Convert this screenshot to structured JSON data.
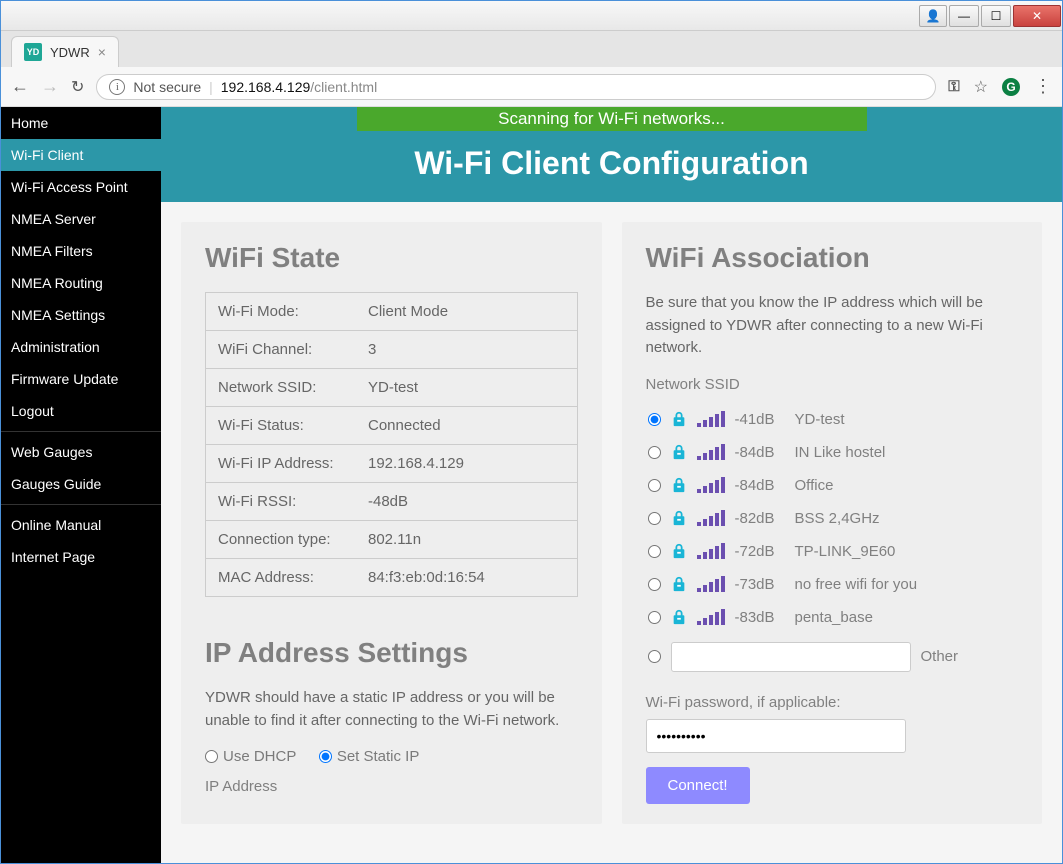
{
  "browser": {
    "tab_title": "YDWR",
    "not_secure_label": "Not secure",
    "url_host": "192.168.4.129",
    "url_path": "/client.html"
  },
  "sidebar": {
    "items": [
      "Home",
      "Wi-Fi Client",
      "Wi-Fi Access Point",
      "NMEA Server",
      "NMEA Filters",
      "NMEA Routing",
      "NMEA Settings",
      "Administration",
      "Firmware Update",
      "Logout"
    ],
    "group2": [
      "Web Gauges",
      "Gauges Guide"
    ],
    "group3": [
      "Online Manual",
      "Internet Page"
    ],
    "active_index": 1
  },
  "header": {
    "banner": "Scanning for Wi-Fi networks...",
    "title": "Wi-Fi Client Configuration"
  },
  "wifi_state": {
    "title": "WiFi State",
    "rows": [
      {
        "label": "Wi-Fi Mode:",
        "value": "Client Mode"
      },
      {
        "label": "WiFi Channel:",
        "value": "3"
      },
      {
        "label": "Network SSID:",
        "value": "YD-test"
      },
      {
        "label": "Wi-Fi Status:",
        "value": "Connected"
      },
      {
        "label": "Wi-Fi IP Address:",
        "value": "192.168.4.129"
      },
      {
        "label": "Wi-Fi RSSI:",
        "value": "-48dB"
      },
      {
        "label": "Connection type:",
        "value": "802.11n"
      },
      {
        "label": "MAC Address:",
        "value": "84:f3:eb:0d:16:54"
      }
    ]
  },
  "ip_settings": {
    "title": "IP Address Settings",
    "help": "YDWR should have a static IP address or you will be unable to find it after connecting to the Wi-Fi network.",
    "dhcp_label": "Use DHCP",
    "static_label": "Set Static IP",
    "selected": "static",
    "ip_field_label": "IP Address"
  },
  "association": {
    "title": "WiFi Association",
    "help": "Be sure that you know the IP address which will be assigned to YDWR after connecting to a new Wi-Fi network.",
    "network_ssid_label": "Network SSID",
    "networks": [
      {
        "locked": true,
        "rssi": "-41dB",
        "ssid": "YD-test",
        "selected": true
      },
      {
        "locked": true,
        "rssi": "-84dB",
        "ssid": "IN Like hostel",
        "selected": false
      },
      {
        "locked": true,
        "rssi": "-84dB",
        "ssid": "Office",
        "selected": false
      },
      {
        "locked": true,
        "rssi": "-82dB",
        "ssid": "BSS 2,4GHz",
        "selected": false
      },
      {
        "locked": true,
        "rssi": "-72dB",
        "ssid": "TP-LINK_9E60",
        "selected": false
      },
      {
        "locked": true,
        "rssi": "-73dB",
        "ssid": "no free wifi for you",
        "selected": false
      },
      {
        "locked": true,
        "rssi": "-83dB",
        "ssid": "penta_base",
        "selected": false
      }
    ],
    "other_label": "Other",
    "other_value": "",
    "password_label": "Wi-Fi password, if applicable:",
    "password_value": "••••••••••",
    "connect_label": "Connect!"
  }
}
